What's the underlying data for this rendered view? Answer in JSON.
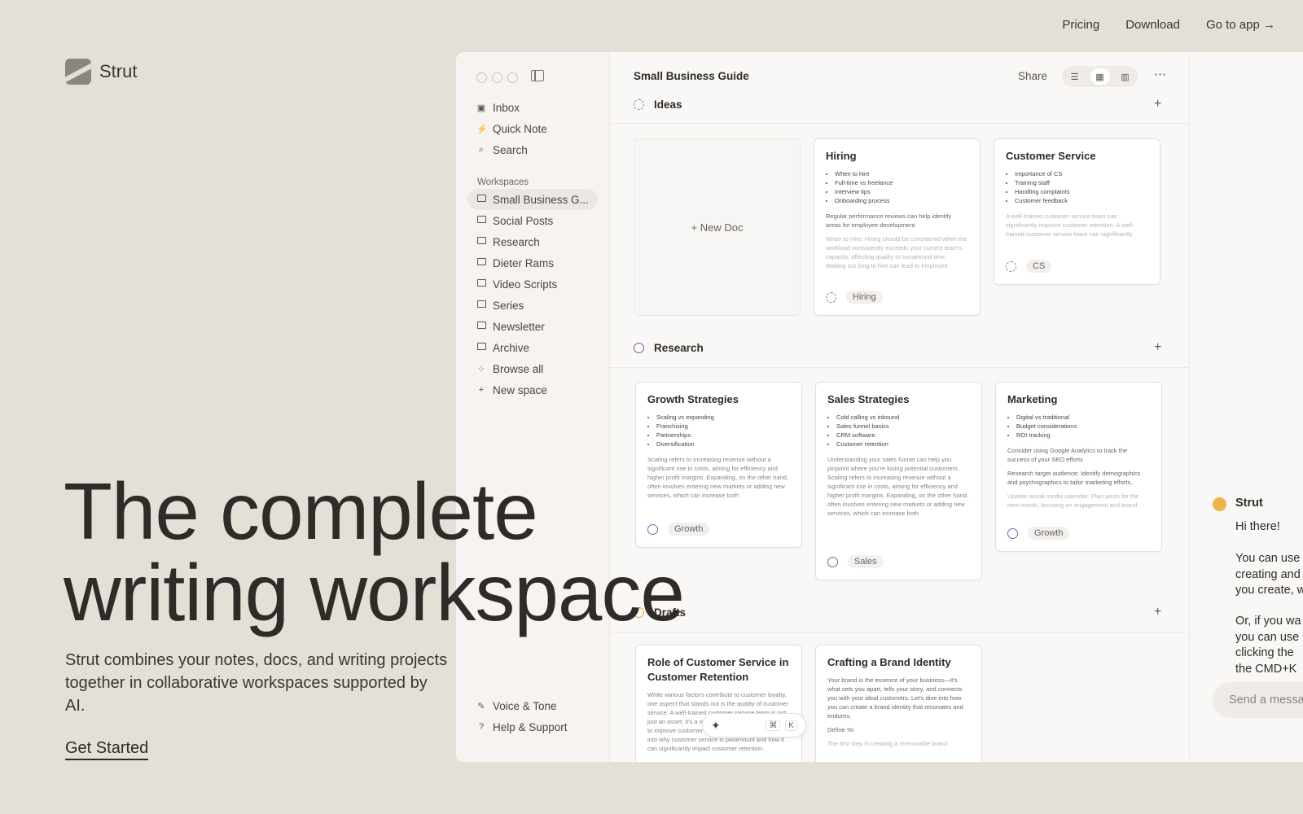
{
  "topnav": {
    "pricing": "Pricing",
    "download": "Download",
    "go_to_app": "Go to app →"
  },
  "brand": {
    "name": "Strut"
  },
  "hero": {
    "title_line1": "The complete",
    "title_line2": "writing workspace",
    "subtitle": "Strut combines your notes, docs, and writing projects together in collaborative workspaces supported by AI.",
    "cta": "Get Started"
  },
  "sidebar": {
    "top": [
      {
        "label": "Inbox",
        "icon": "inbox-icon"
      },
      {
        "label": "Quick Note",
        "icon": "bolt-icon"
      },
      {
        "label": "Search",
        "icon": "search-icon"
      }
    ],
    "workspaces_label": "Workspaces",
    "workspaces": [
      {
        "label": "Small Business G..."
      },
      {
        "label": "Social Posts"
      },
      {
        "label": "Research"
      },
      {
        "label": "Dieter Rams"
      },
      {
        "label": "Video Scripts"
      },
      {
        "label": "Series"
      },
      {
        "label": "Newsletter"
      },
      {
        "label": "Archive"
      }
    ],
    "browse_all": "Browse all",
    "new_space": "New space",
    "bottom": [
      {
        "label": "Voice & Tone",
        "icon": "pen-icon"
      },
      {
        "label": "Help & Support",
        "icon": "help-icon"
      }
    ]
  },
  "main": {
    "doc_title": "Small Business Guide",
    "share": "Share",
    "sections": [
      {
        "name": "Ideas"
      },
      {
        "name": "Research"
      },
      {
        "name": "Drafts"
      }
    ],
    "new_doc": "+ New Doc",
    "cards": {
      "hiring": {
        "title": "Hiring",
        "bullets": [
          "When to hire",
          "Full-time vs freelance",
          "Interview tips",
          "Onboarding process"
        ],
        "p1": "Regular performance reviews can help identify areas for employee development.",
        "p2": "When to Hire: Hiring should be considered when the workload consistently exceeds your current team's capacity, affecting quality or turnaround time. Waiting too long to hire can lead to employee burnout and decreased customer satisfaction.",
        "tag": "Hiring"
      },
      "cs": {
        "title": "Customer Service",
        "bullets": [
          "Importance of CS",
          "Training staff",
          "Handling complaints",
          "Customer feedback"
        ],
        "p1": "A well-trained customer service team can significantly improve customer retention. A well-trained customer service team can significantly",
        "tag": "CS"
      },
      "growth": {
        "title": "Growth Strategies",
        "bullets": [
          "Scaling vs expanding",
          "Franchising",
          "Partnerships",
          "Diversification"
        ],
        "p1": "Scaling refers to increasing revenue without a significant rise in costs, aiming for efficiency and higher profit margins. Expanding, on the other hand, often involves entering new markets or adding new services, which can increase both",
        "tag": "Growth"
      },
      "sales": {
        "title": "Sales Strategies",
        "bullets": [
          "Cold calling vs inbound",
          "Sales funnel basics",
          "CRM software",
          "Customer retention"
        ],
        "p1": "Understanding your sales funnel can help you pinpoint where you're losing potential customers. Scaling refers to increasing revenue without a significant rise in costs, aiming for efficiency and higher profit margins. Expanding, on the other hand, often involves entering new markets or adding new services, which can increase both",
        "tag": "Sales"
      },
      "marketing": {
        "title": "Marketing",
        "bullets": [
          "Digital vs traditional",
          "Budget considerations",
          "ROI tracking"
        ],
        "p1": "Consider using Google Analytics to track the success of your SEO efforts",
        "p2": "Research target audience: Identify demographics and psychographics to tailor marketing efforts.",
        "p3": "Update social media calendar: Plan posts for the next month, focusing on engagement and brand",
        "tag": "Growth"
      },
      "role": {
        "title": "Role of Customer Service in Customer Retention",
        "p1": "While various factors contribute to customer loyalty, one aspect that stands out is the quality of customer service. A well-trained customer service team is not just an asset; it's a necessity for businesses aiming to improve customer retention. This blog post delves into why customer service is paramount and how it can significantly impact customer retention."
      },
      "brand": {
        "title": "Crafting a Brand Identity",
        "p1": "Your brand is the essence of your business—it's what sets you apart, tells your story, and connects you with your ideal customers. Let's dive into how you can create a brand identity that resonates and endures.",
        "p2": "Define Yo",
        "p3": "The first step in creating a memorable brand"
      }
    },
    "ai_bar": {
      "key1": "⌘",
      "key2": "K"
    }
  },
  "chat": {
    "name": "Strut",
    "greeting": "Hi there!",
    "msg1": "You can use\ncreating and\nyou create, w",
    "msg2": "Or, if you wa\nyou can use\nclicking the\nthe CMD+K",
    "input_placeholder": "Send a messa"
  },
  "colors": {
    "accent_purple": "#7b5ea7",
    "accent_orange": "#e8a33c",
    "chat_dot": "#f0b34a",
    "background": "#e4e0d8"
  }
}
